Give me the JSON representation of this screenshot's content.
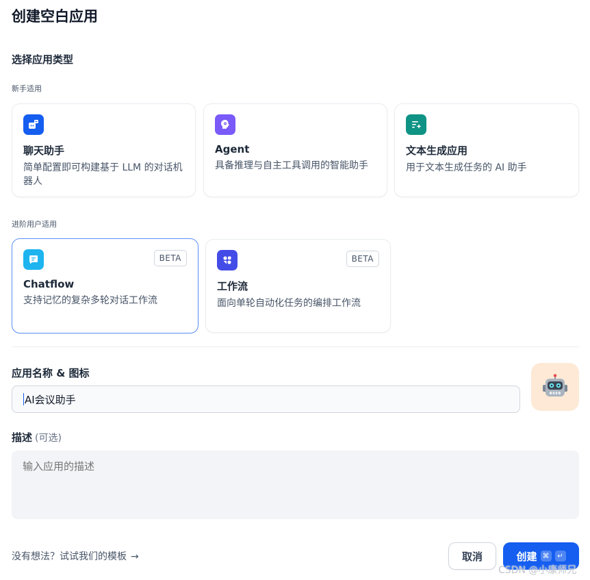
{
  "title": "创建空白应用",
  "section_title": "选择应用类型",
  "groups": [
    {
      "label": "新手适用",
      "cards": [
        {
          "title": "聊天助手",
          "desc": "简单配置即可构建基于 LLM 的对话机器人",
          "icon": "chat-bot-icon",
          "color": "#155eef"
        },
        {
          "title": "Agent",
          "desc": "具备推理与自主工具调用的智能助手",
          "icon": "agent-icon",
          "color": "#7a5af8"
        },
        {
          "title": "文本生成应用",
          "desc": "用于文本生成任务的 AI 助手",
          "icon": "text-generation-icon",
          "color": "#0e9384"
        }
      ]
    },
    {
      "label": "进阶用户适用",
      "cards": [
        {
          "title": "Chatflow",
          "desc": "支持记忆的复杂多轮对话工作流",
          "badge": "BETA",
          "icon": "chatflow-icon",
          "color": "#1db4f0",
          "selected": true
        },
        {
          "title": "工作流",
          "desc": "面向单轮自动化任务的编排工作流",
          "badge": "BETA",
          "icon": "workflow-icon",
          "color": "#444ce7"
        }
      ]
    }
  ],
  "name_field": {
    "label": "应用名称 & 图标",
    "value": "AI会议助手",
    "avatar_icon": "robot-icon",
    "avatar_bg": "#fde9d5"
  },
  "desc_field": {
    "label": "描述",
    "optional": "(可选)",
    "placeholder": "输入应用的描述"
  },
  "template_link": "没有想法？试试我们的模板",
  "buttons": {
    "cancel": "取消",
    "create": "创建",
    "shortcut_cmd": "⌘",
    "shortcut_enter": "↵"
  },
  "watermark": "CSDN @小康师兄",
  "accent_color": "#155eef"
}
